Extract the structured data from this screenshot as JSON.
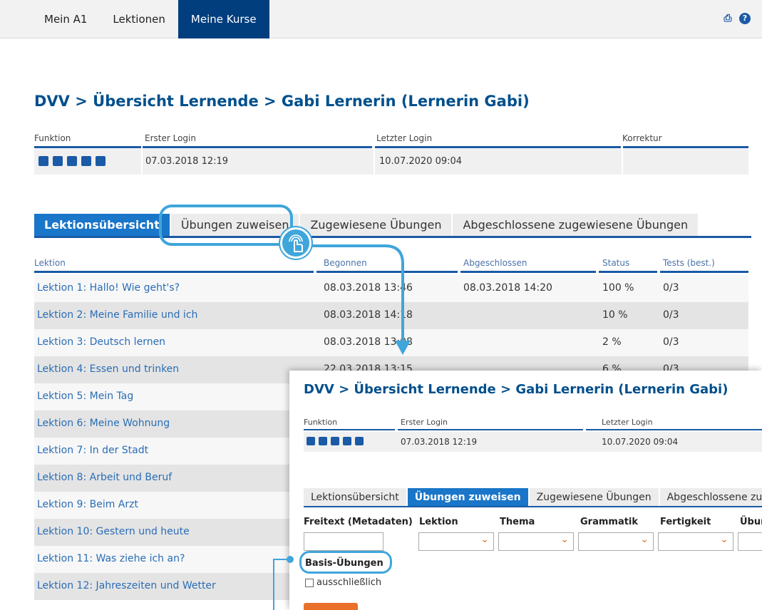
{
  "topnav": {
    "items": [
      {
        "label": "Mein A1"
      },
      {
        "label": "Lektionen"
      },
      {
        "label": "Meine Kurse"
      }
    ],
    "icons": [
      "printer-icon",
      "help-icon"
    ]
  },
  "page": {
    "title": "DVV > Übersicht Lernende > Gabi Lernerin (Lernerin Gabi)"
  },
  "info": {
    "headers": {
      "funktion": "Funktion",
      "erster": "Erster Login",
      "letzter": "Letzter Login",
      "korrektur": "Korrektur"
    },
    "erster_login": "07.03.2018 12:19",
    "letzter_login": "10.07.2020 09:04",
    "function_icons": [
      "copy-icon",
      "mail-icon",
      "id-card-icon",
      "notes-icon",
      "trash-icon"
    ]
  },
  "tabs": [
    {
      "label": "Lektionsübersicht"
    },
    {
      "label": "Übungen zuweisen"
    },
    {
      "label": "Zugewiesene Übungen"
    },
    {
      "label": "Abgeschlossene zugewiesene Übungen"
    }
  ],
  "lessons": {
    "headers": {
      "lektion": "Lektion",
      "begonnen": "Begonnen",
      "abgeschlossen": "Abgeschlossen",
      "status": "Status",
      "tests": "Tests (best.)"
    },
    "rows": [
      {
        "name": "Lektion 1: Hallo! Wie geht's?",
        "begonnen": "08.03.2018 13:46",
        "abgeschlossen": "08.03.2018 14:20",
        "status": "100 %",
        "tests": "0/3"
      },
      {
        "name": "Lektion 2: Meine Familie und ich",
        "begonnen": "08.03.2018 14:18",
        "abgeschlossen": "",
        "status": "10 %",
        "tests": "0/3"
      },
      {
        "name": "Lektion 3: Deutsch lernen",
        "begonnen": "08.03.2018 13:08",
        "abgeschlossen": "",
        "status": "2 %",
        "tests": "0/3"
      },
      {
        "name": "Lektion 4: Essen und trinken",
        "begonnen": "22.03.2018 13:15",
        "abgeschlossen": "",
        "status": "6 %",
        "tests": "0/3"
      },
      {
        "name": "Lektion 5: Mein Tag",
        "begonnen": "",
        "abgeschlossen": "",
        "status": "",
        "tests": ""
      },
      {
        "name": "Lektion 6: Meine Wohnung",
        "begonnen": "",
        "abgeschlossen": "",
        "status": "",
        "tests": ""
      },
      {
        "name": "Lektion 7: In der Stadt",
        "begonnen": "",
        "abgeschlossen": "",
        "status": "",
        "tests": ""
      },
      {
        "name": "Lektion 8: Arbeit und Beruf",
        "begonnen": "",
        "abgeschlossen": "",
        "status": "",
        "tests": ""
      },
      {
        "name": "Lektion 9: Beim Arzt",
        "begonnen": "",
        "abgeschlossen": "",
        "status": "",
        "tests": ""
      },
      {
        "name": "Lektion 10: Gestern und heute",
        "begonnen": "",
        "abgeschlossen": "",
        "status": "",
        "tests": ""
      },
      {
        "name": "Lektion 11: Was ziehe ich an?",
        "begonnen": "",
        "abgeschlossen": "",
        "status": "",
        "tests": ""
      },
      {
        "name": "Lektion 12: Jahreszeiten und Wetter",
        "begonnen": "",
        "abgeschlossen": "",
        "status": "",
        "tests": ""
      }
    ]
  },
  "inset": {
    "title": "DVV > Übersicht Lernende > Gabi Lernerin (Lernerin Gabi)",
    "headers": {
      "funktion": "Funktion",
      "erster": "Erster Login",
      "letzter": "Letzter Login"
    },
    "erster_login": "07.03.2018 12:19",
    "letzter_login": "10.07.2020 09:04",
    "tabs": [
      {
        "label": "Lektionsübersicht"
      },
      {
        "label": "Übungen zuweisen"
      },
      {
        "label": "Zugewiesene Übungen"
      },
      {
        "label": "Abgeschlossene zugewiesene Übungen"
      }
    ],
    "filters": {
      "freitext": "Freitext (Metadaten)",
      "lektion": "Lektion",
      "thema": "Thema",
      "grammatik": "Grammatik",
      "fertigkeit": "Fertigkeit",
      "uebung": "Übungstyp"
    },
    "basis_label": "Basis-Übungen",
    "checkbox_label": "ausschließlich"
  },
  "colors": {
    "primary": "#1a76c8",
    "dark_blue": "#003e7e",
    "callout": "#3fa6db",
    "orange": "#e8702a"
  }
}
